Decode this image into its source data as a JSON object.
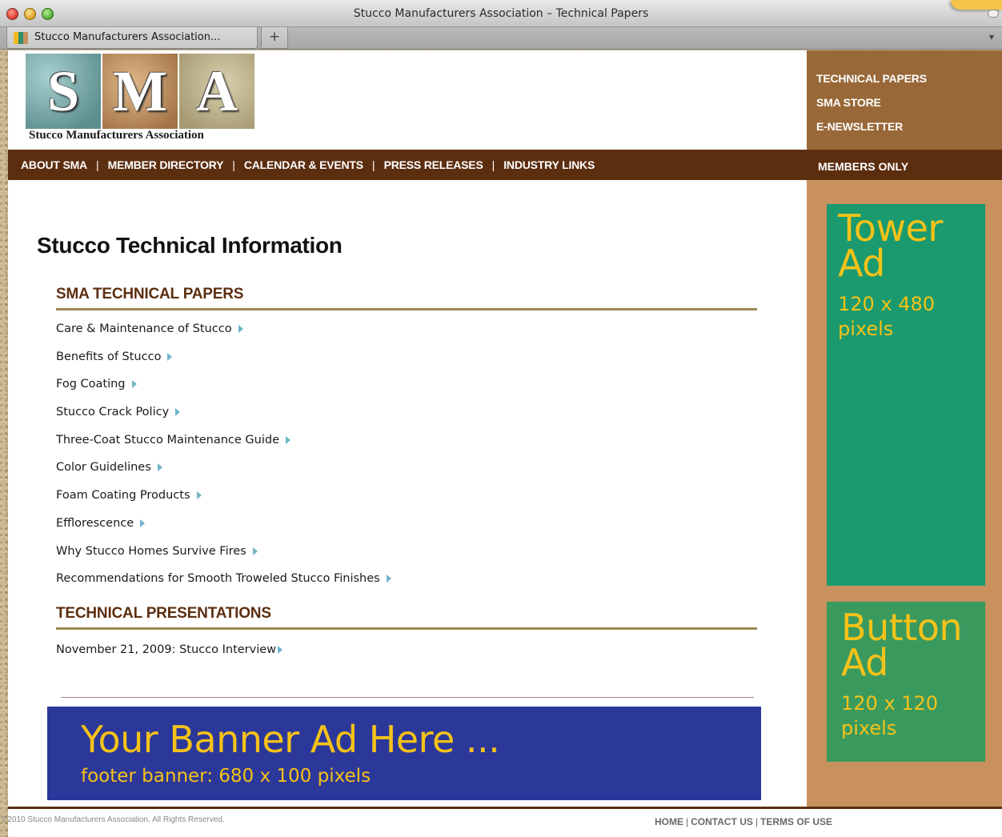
{
  "window": {
    "title": "Stucco Manufacturers Association – Technical Papers"
  },
  "tabs": [
    {
      "label": "Stucco Manufacturers Association..."
    }
  ],
  "new_tab_label": "+",
  "logo": {
    "letters": [
      "S",
      "M",
      "A"
    ],
    "caption": "Stucco Manufacturers Association"
  },
  "side_nav": [
    "TECHNICAL PAPERS",
    "SMA STORE",
    "E-NEWSLETTER"
  ],
  "main_nav": [
    "ABOUT SMA",
    "MEMBER DIRECTORY",
    "CALENDAR & EVENTS",
    "PRESS RELEASES",
    "INDUSTRY LINKS"
  ],
  "nav_separator": "|",
  "members_link": "MEMBERS ONLY",
  "page_title": "Stucco Technical Information",
  "sections": {
    "papers": {
      "heading": "SMA TECHNICAL PAPERS",
      "items": [
        "Care & Maintenance of Stucco",
        "Benefits of Stucco",
        "Fog Coating",
        "Stucco Crack Policy",
        "Three-Coat Stucco Maintenance Guide",
        "Color Guidelines",
        "Foam Coating Products",
        "Efflorescence",
        "Why Stucco Homes Survive Fires",
        "Recommendations for Smooth Troweled Stucco Finishes"
      ]
    },
    "presentations": {
      "heading": "TECHNICAL PRESENTATIONS",
      "items": [
        "November 21, 2009: Stucco Interview"
      ]
    }
  },
  "ads": {
    "tower": {
      "line1": "Tower",
      "line2": "Ad",
      "size_line1": "120 x 480",
      "size_line2": "pixels"
    },
    "button": {
      "line1": "Button",
      "line2": "Ad",
      "size_line1": "120 x 120",
      "size_line2": "pixels"
    },
    "banner": {
      "headline": "Your Banner Ad Here ...",
      "subline": "footer banner:  680 x 100 pixels"
    }
  },
  "footer": {
    "copyright": "©2010 Stucco Manufacturers Association. All Rights Reserved.",
    "links": [
      "HOME",
      "CONTACT US",
      "TERMS OF USE"
    ],
    "separator": "|"
  },
  "colors": {
    "nav_brown": "#5c2e10",
    "sidebar_tan": "#c9915e",
    "side_top_brown": "#996838",
    "tower_green": "#1a9a6e",
    "button_green": "#3a9a5e",
    "banner_blue": "#2c3899",
    "ad_text_yellow": "#f5c219",
    "rule_olive": "#9a8a52"
  }
}
